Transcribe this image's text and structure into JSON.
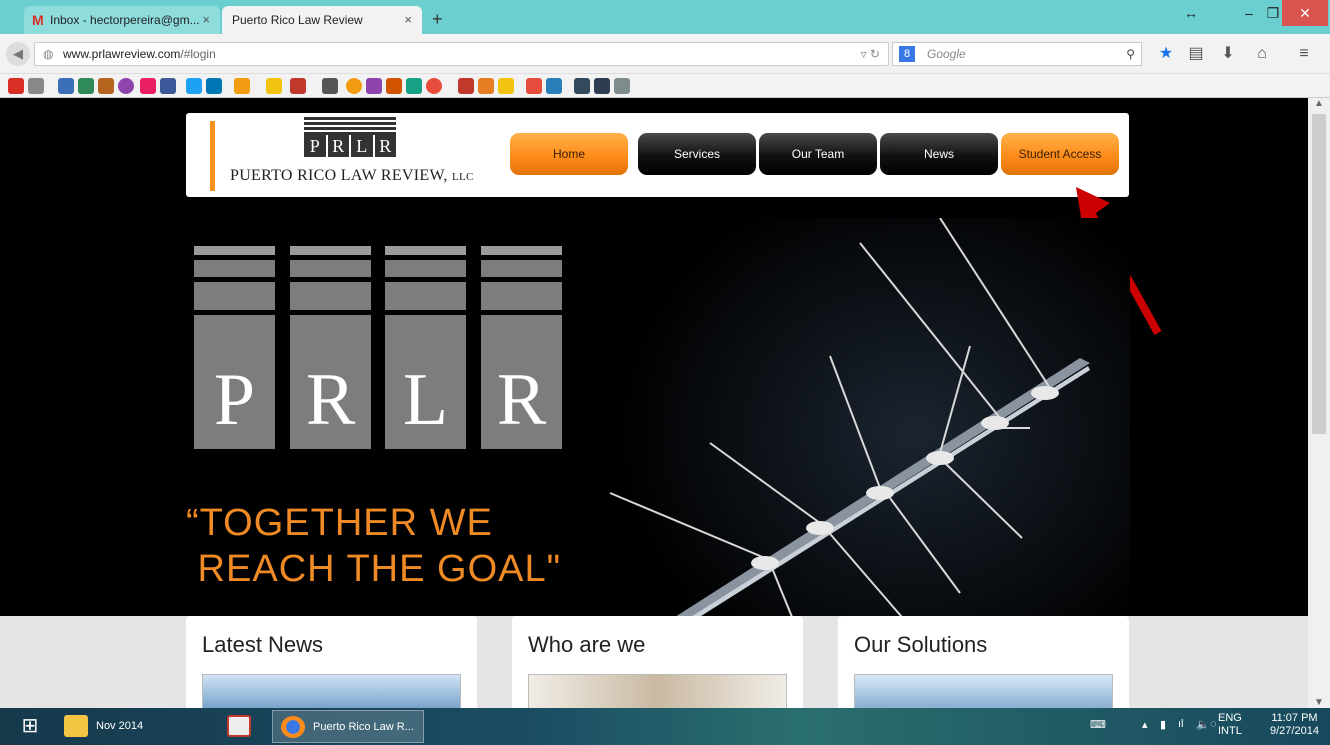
{
  "browser": {
    "tabs": [
      {
        "label": "Inbox - hectorpereira@gm...",
        "active": false
      },
      {
        "label": "Puerto Rico Law Review",
        "active": true
      }
    ],
    "new_tab_glyph": "+",
    "close_glyph": "×",
    "url_host": "www.prlawreview.com",
    "url_path": "/#login",
    "search_placeholder": "Google",
    "window_controls": {
      "resize": "↔",
      "minimize": "–",
      "maximize": "❐",
      "close": "✕"
    }
  },
  "site": {
    "logo_letters": [
      "P",
      "R",
      "L",
      "R"
    ],
    "logo_name": "PUERTO RICO LAW REVIEW,",
    "logo_suffix": "LLC",
    "menu": [
      {
        "label": "Home",
        "style": "orange"
      },
      {
        "label": "Services",
        "style": "black"
      },
      {
        "label": "Our Team",
        "style": "black"
      },
      {
        "label": "News",
        "style": "black"
      },
      {
        "label": "Student Access",
        "style": "orange"
      }
    ],
    "big_logo_letters": [
      "P",
      "R",
      "L",
      "R"
    ],
    "slogan_line1": "“TOGETHER WE",
    "slogan_line2": " REACH THE GOAL\"",
    "panels": [
      {
        "title": "Latest News"
      },
      {
        "title": "Who are we"
      },
      {
        "title": "Our Solutions"
      }
    ],
    "accent_color": "#f7931e",
    "annotation_arrow_color": "#cc0000"
  },
  "taskbar": {
    "items": [
      {
        "label": "Nov 2014"
      },
      {
        "label": ""
      },
      {
        "label": "Puerto Rico Law R..."
      }
    ],
    "lang_line1": "ENG",
    "lang_line2": "INTL",
    "time": "11:07 PM",
    "date": "9/27/2014"
  }
}
